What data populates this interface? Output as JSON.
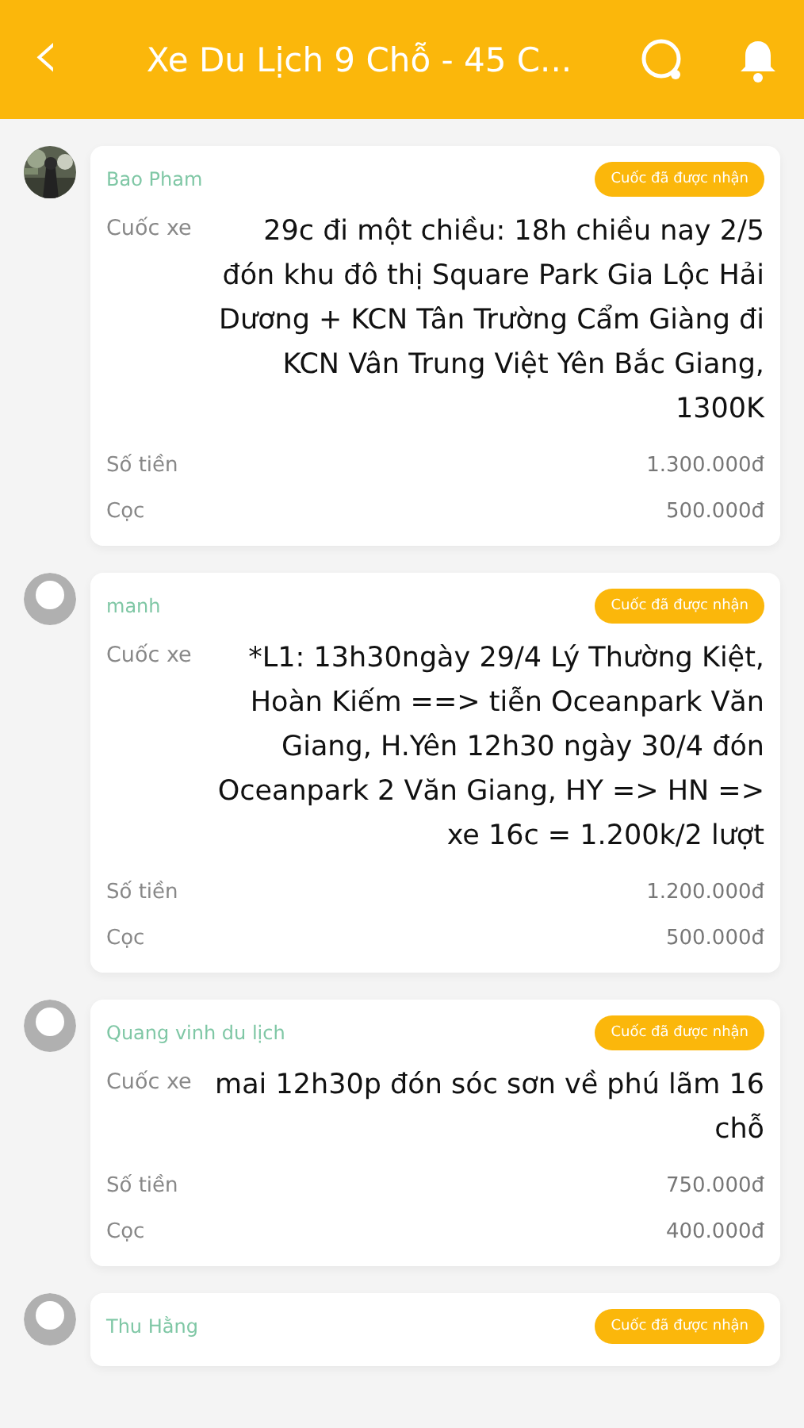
{
  "header": {
    "back_icon": "‹",
    "title": "Xe Du Lịch 9 Chỗ - 45 C..."
  },
  "posts": [
    {
      "author": "Bao Pham",
      "badge": "Cuốc đã được nhận",
      "trip_label": "Cuốc xe",
      "trip": "29c đi một chiều: 18h chiều nay 2/5 đón khu đô thị Square Park Gia Lộc Hải Dương + KCN Tân Trường Cẩm Giàng đi KCN Vân Trung Việt Yên Bắc Giang, 1300K",
      "amount_label": "Số tiền",
      "amount": "1.300.000đ",
      "deposit_label": "Cọc",
      "deposit": "500.000đ"
    },
    {
      "avatar": {
        "kind": "default"
      },
      "author": "manh",
      "badge": "Cuốc đã được nhận",
      "trip_label": "Cuốc xe",
      "trip": "*L1: 13h30ngày 29/4  Lý Thường Kiệt, Hoàn Kiếm ==> tiễn Oceanpark Văn Giang, H.Yên 12h30 ngày 30/4 đón Oceanpark 2 Văn Giang, HY => HN => xe 16c = 1.200k/2 lượt",
      "amount_label": "Số tiền",
      "amount": "1.200.000đ",
      "deposit_label": "Cọc",
      "deposit": "500.000đ"
    },
    {
      "avatar": {
        "kind": "default"
      },
      "author": "Quang vinh du lịch",
      "badge": "Cuốc đã được nhận",
      "trip_label": "Cuốc xe",
      "trip": "mai 12h30p đón sóc sơn về phú lãm 16 chỗ",
      "amount_label": "Số tiền",
      "amount": "750.000đ",
      "deposit_label": "Cọc",
      "deposit": "400.000đ"
    },
    {
      "avatar": {
        "kind": "default"
      },
      "author": "Thu Hằng",
      "badge": "Cuốc đã được nhận"
    }
  ]
}
